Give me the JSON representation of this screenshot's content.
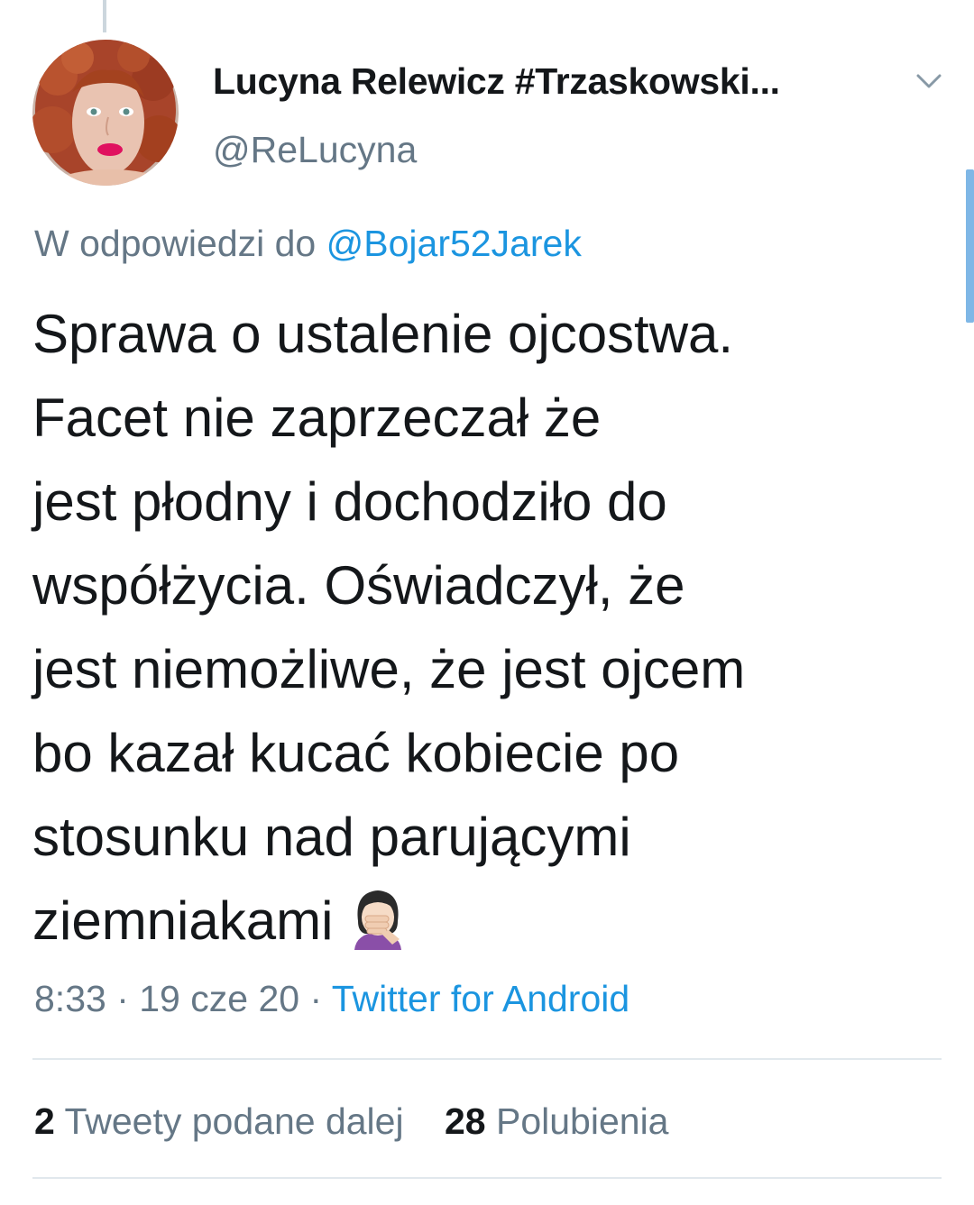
{
  "colors": {
    "text_primary": "#14171a",
    "text_secondary": "#657786",
    "link": "#1b95e0",
    "divider": "#e1e8ed",
    "scrollbar": "#7fb7e6"
  },
  "author": {
    "display_name": "Lucyna Relewicz #Trzaskowski...",
    "handle": "@ReLucyna",
    "avatar_icon": "profile-photo"
  },
  "reply": {
    "prefix": "W odpowiedzi do",
    "to_handle": "@Bojar52Jarek"
  },
  "tweet": {
    "lines": [
      "Sprawa o ustalenie ojcostwa.",
      "Facet nie zaprzeczał że",
      "jest płodny i dochodziło do",
      "współżycia. Oświadczył, że",
      "jest niemożliwe, że jest ojcem",
      "bo kazał kucać kobiecie po",
      "stosunku nad parującymi",
      "ziemniakami"
    ],
    "emoji": "woman-facepalming-icon"
  },
  "meta": {
    "time": "8:33",
    "date": "19 cze 20",
    "separator": " · ",
    "source": "Twitter for Android"
  },
  "stats": {
    "retweets_count": "2",
    "retweets_label": "Tweety podane dalej",
    "likes_count": "28",
    "likes_label": "Polubienia"
  }
}
